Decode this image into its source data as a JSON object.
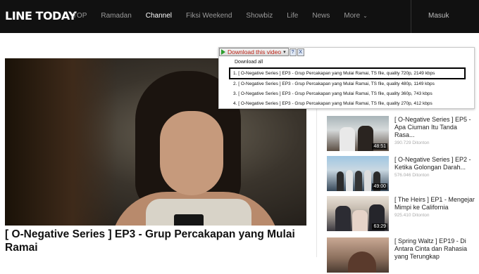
{
  "header": {
    "logo": "LINE TODAY",
    "nav": [
      "TOP",
      "Ramadan",
      "Channel",
      "Fiksi Weekend",
      "Showbiz",
      "Life",
      "News",
      "More"
    ],
    "active_nav": "Channel",
    "login": "Masuk"
  },
  "downloader": {
    "button_label": "Download this video",
    "help_label": "?",
    "close_label": "X",
    "download_all": "Download all",
    "options": [
      "1.  [ O-Negative Series ] EP3 - Grup Percakapan yang Mulai Ramai,  TS file, quality 720p, 2149 kbps",
      "2.  [ O-Negative Series ] EP3 - Grup Percakapan yang Mulai Ramai,  TS file, quality 480p, 1149 kbps",
      "3.  [ O-Negative Series ] EP3 - Grup Percakapan yang Mulai Ramai,  TS file, quality 360p, 743 kbps",
      "4.  [ O-Negative Series ] EP3 - Grup Percakapan yang Mulai Ramai,  TS file, quality 270p, 412 kbps"
    ],
    "selected_index": 0
  },
  "video": {
    "title": "[ O-Negative Series ] EP3 - Grup Percakapan yang Mulai Ramai"
  },
  "related": [
    {
      "title": "[ O-Negative Series ] EP5 - Apa Ciuman Itu Tanda Rasa...",
      "views": "390.729 Ditonton",
      "duration": "48:51"
    },
    {
      "title": "[ O-Negative Series ] EP2 - Ketika Golongan Darah...",
      "views": "576.046 Ditonton",
      "duration": "49:00"
    },
    {
      "title": "[ The Heirs ] EP1 - Mengejar Mimpi ke California",
      "views": "925.410 Ditonton",
      "duration": "63:29"
    },
    {
      "title": "[ Spring Waltz ] EP19 - Di Antara Cinta dan Rahasia yang Terungkap",
      "views": "",
      "duration": ""
    }
  ],
  "colors": {
    "topbar": "#111111",
    "download_label": "#c0281c",
    "play_icon": "#2e9e2e"
  }
}
